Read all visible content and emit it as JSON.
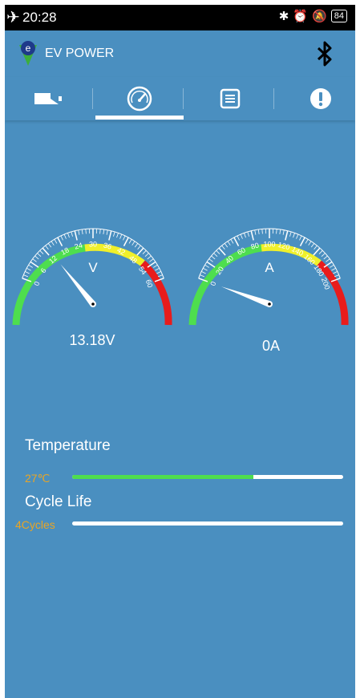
{
  "status_bar": {
    "time": "20:28",
    "battery": "84"
  },
  "app": {
    "title": "EV POWER"
  },
  "tabs": [
    {
      "icon": "battery-icon",
      "selected": false
    },
    {
      "icon": "speedometer-icon",
      "selected": true
    },
    {
      "icon": "list-icon",
      "selected": false
    },
    {
      "icon": "alert-icon",
      "selected": false
    }
  ],
  "voltage_gauge": {
    "unit": "V",
    "min": 0,
    "max": 60,
    "tick_labels": [
      "0",
      "6",
      "12",
      "18",
      "24",
      "30",
      "36",
      "42",
      "48",
      "54",
      "60"
    ],
    "value": 13.18,
    "readout": "13.18V"
  },
  "current_gauge": {
    "unit": "A",
    "min": 0,
    "max": 200,
    "tick_labels": [
      "0",
      "20",
      "40",
      "60",
      "80",
      "100",
      "120",
      "140",
      "160",
      "180",
      "200"
    ],
    "value": 0,
    "readout": "0A"
  },
  "temperature": {
    "label": "Temperature",
    "value": "27℃",
    "fill_fraction": 0.67
  },
  "cycle_life": {
    "label": "Cycle Life",
    "value": "4Cycles",
    "fill_fraction": 0.0
  },
  "colors": {
    "background": "#4a8fc0",
    "green": "#4ede4e",
    "yellow": "#f0f02a",
    "red": "#e81c1c",
    "value_text": "#e9a524"
  }
}
